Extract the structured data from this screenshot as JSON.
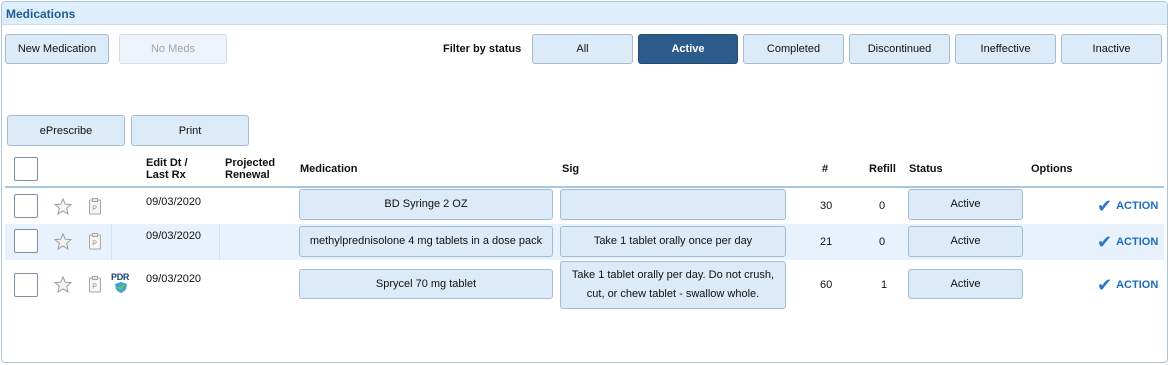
{
  "panel": {
    "title": "Medications"
  },
  "toolbar": {
    "new_medication": "New Medication",
    "no_meds": "No Meds",
    "filter_label": "Filter by status",
    "filters": [
      "All",
      "Active",
      "Completed",
      "Discontinued",
      "Ineffective",
      "Inactive"
    ],
    "selected_filter": "Active",
    "eprescribe": "ePrescribe",
    "print": "Print"
  },
  "table": {
    "headers": {
      "edit_dt_line1": "Edit Dt /",
      "edit_dt_line2": "Last Rx",
      "projected_line1": "Projected",
      "projected_line2": "Renewal",
      "medication": "Medication",
      "sig": "Sig",
      "count": "#",
      "refill": "Refill",
      "status": "Status",
      "options": "Options"
    },
    "rows": [
      {
        "edit_dt": "09/03/2020",
        "medication": "BD Syringe 2 OZ",
        "sig_line1": "",
        "sig_line2": "",
        "count": "30",
        "refill": "0",
        "status": "Active",
        "action": "ACTION",
        "pdr": false
      },
      {
        "edit_dt": "09/03/2020",
        "medication": "methylprednisolone 4 mg tablets in a dose pack",
        "sig_line1": "Take 1 tablet orally once per day",
        "sig_line2": "",
        "count": "21",
        "refill": "0",
        "status": "Active",
        "action": "ACTION",
        "pdr": false
      },
      {
        "edit_dt": "09/03/2020",
        "medication": "Sprycel 70 mg tablet",
        "sig_line1": "Take 1 tablet orally per day. Do not crush,",
        "sig_line2": "cut, or chew tablet - swallow whole.",
        "count": "60",
        "refill": "1",
        "status": "Active",
        "action": "ACTION",
        "pdr": true,
        "pdr_label": "PDR"
      }
    ]
  },
  "colors": {
    "header_bg": "#dfeefb",
    "title": "#1f5c99",
    "button_bg": "#ddeaf8",
    "active_filter_bg": "#2c5c8b",
    "row_alt_bg": "#e8f2fc",
    "action_link": "#1a6cc0"
  },
  "icons": [
    "star-icon",
    "document-icon",
    "pdr-badge-icon",
    "checkmark-icon"
  ]
}
